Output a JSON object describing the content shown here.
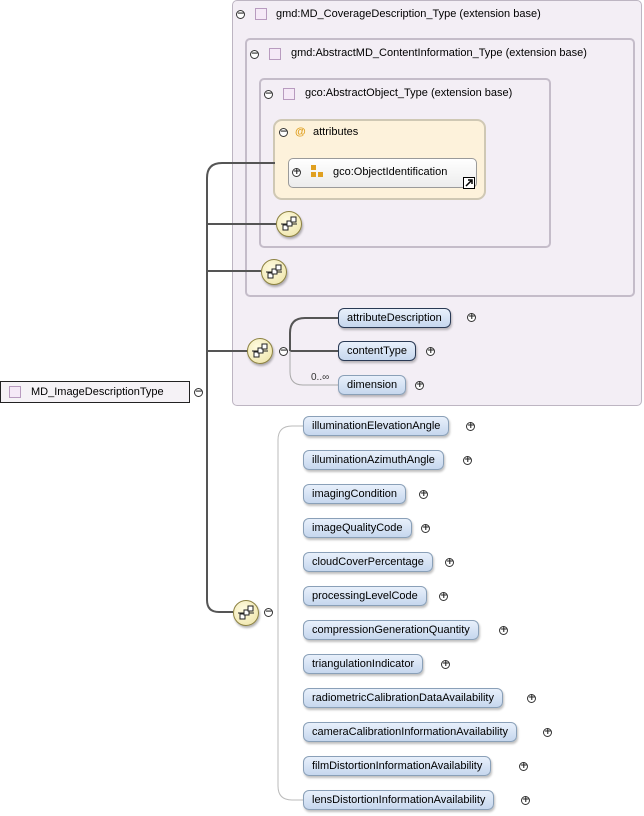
{
  "root_type": "MD_ImageDescriptionType",
  "extension_boxes": [
    {
      "label": "gmd:MD_CoverageDescription_Type (extension base)"
    },
    {
      "label": "gmd:AbstractMD_ContentInformation_Type (extension base)"
    },
    {
      "label": "gco:AbstractObject_Type (extension base)"
    }
  ],
  "attributes_group": {
    "at_symbol": "@",
    "label": "attributes",
    "attribute_group_ref": "gco:ObjectIdentification"
  },
  "coverage_elements": [
    {
      "label": "attributeDescription"
    },
    {
      "label": "contentType"
    },
    {
      "label": "dimension",
      "occurrence": "0..∞"
    }
  ],
  "image_elements": [
    {
      "label": "illuminationElevationAngle"
    },
    {
      "label": "illuminationAzimuthAngle"
    },
    {
      "label": "imagingCondition"
    },
    {
      "label": "imageQualityCode"
    },
    {
      "label": "cloudCoverPercentage"
    },
    {
      "label": "processingLevelCode"
    },
    {
      "label": "compressionGenerationQuantity"
    },
    {
      "label": "triangulationIndicator"
    },
    {
      "label": "radiometricCalibrationDataAvailability"
    },
    {
      "label": "cameraCalibrationInformationAvailability"
    },
    {
      "label": "filmDistortionInformationAvailability"
    },
    {
      "label": "lensDistortionInformationAvailability"
    }
  ],
  "toggle_collapse": "−",
  "toggle_expand": "+"
}
